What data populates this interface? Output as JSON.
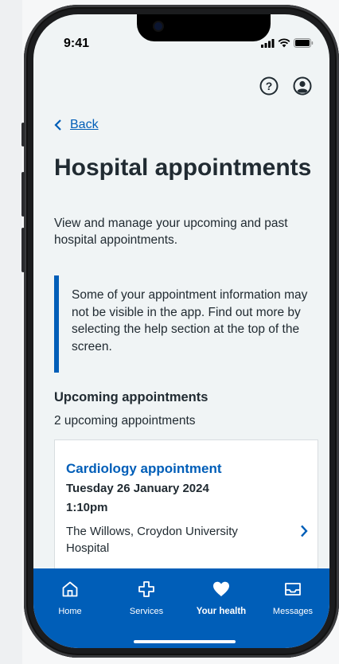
{
  "status_bar": {
    "time": "9:41"
  },
  "header": {
    "help_icon": "help-circle-icon",
    "profile_icon": "profile-icon"
  },
  "nav": {
    "back_label": "Back"
  },
  "page": {
    "title": "Hospital appointments",
    "intro": "View and manage your upcoming and past hospital appointments.",
    "callout": "Some of your appointment information may not be visible in the app. Find out more by selecting the help section at the top of the screen."
  },
  "upcoming": {
    "heading": "Upcoming appointments",
    "count_text": "2 upcoming appointments",
    "appointments": [
      {
        "title": "Cardiology appointment",
        "date": "Tuesday 26 January 2024",
        "time": "1:10pm",
        "location": "The Willows, Croydon University Hospital"
      }
    ]
  },
  "tabbar": {
    "items": [
      {
        "label": "Home",
        "icon": "home-icon"
      },
      {
        "label": "Services",
        "icon": "services-cross-icon"
      },
      {
        "label": "Your health",
        "icon": "heart-icon",
        "active": true
      },
      {
        "label": "Messages",
        "icon": "inbox-icon"
      }
    ]
  },
  "colors": {
    "accent": "#005eb8",
    "text": "#212b32",
    "background": "#f0f4f5"
  }
}
